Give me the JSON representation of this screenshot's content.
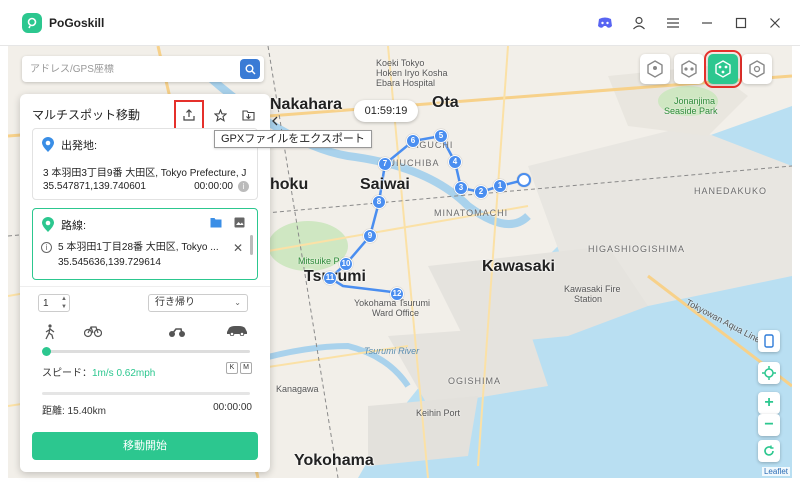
{
  "app": {
    "title": "PoGoskill"
  },
  "search": {
    "placeholder": "アドレス/GPS座標"
  },
  "panel": {
    "title": "マルチスポット移動",
    "start": {
      "label": "出発地:",
      "address": "3 本羽田3丁目9番 大田区, Tokyo Prefecture, J",
      "coords": "35.547871,139.740601",
      "time": "00:00:00"
    },
    "route": {
      "label": "路線:",
      "address": "5 本羽田1丁目28番 大田区, Tokyo ...",
      "coords": "35.545636,139.729614"
    },
    "repeat_count": "1",
    "mode_select": "行き帰り",
    "speed_label": "スピード：",
    "speed_value": "1m/s 0.62mph",
    "km": "K",
    "mi": "M",
    "distance": "距離: 15.40km",
    "elapsed": "00:00:00",
    "start_button": "移動開始"
  },
  "tooltip": "GPXファイルをエクスポート",
  "timer": "01:59:19",
  "map": {
    "labels": {
      "nakahara": "Nakahara",
      "ota": "Ota",
      "saiwai": "Saiwai",
      "kawasaki": "Kawasaki",
      "tsurumi": "Tsurumi",
      "yokohama": "Yokohama",
      "hoku": "hoku",
      "koeki": "Koeki Tokyo",
      "koeki2": "Hoken Iryo Kosha",
      "koeki3": "Ebara Hospital",
      "jonanjima": "Jonanjima",
      "jonanjima2": "Seaside Park",
      "yaguchi": "YAGUCHI",
      "fuiuchiba": "FUIUCHIBA",
      "minatomachi": "MINATOMACHI",
      "hanedaairport": "HANEDAKUKO",
      "higashiogishima": "HIGASHIOGISHIMA",
      "mitsuike": "Mitsuike Park",
      "kawasaki_fire": "Kawasaki Fire",
      "kawasaki_fire2": "Station",
      "yokohama_ward": "Yokohama Tsurumi",
      "yokohama_ward2": "Ward Office",
      "tsurumi_river": "Tsurumi River",
      "ogishima": "OGISHIMA",
      "keihin": "Keihin Port",
      "tokyowan": "Tokyowan Aqua Line",
      "kanagawa": "Kanagawa",
      "tsurumi_mk": "Tsurumi"
    },
    "route_markers": [
      "1",
      "2",
      "3",
      "4",
      "5",
      "6",
      "7",
      "8",
      "9",
      "10",
      "11",
      "12"
    ],
    "leaflet": "Leaflet"
  },
  "controls": {
    "zoom_in": "+",
    "zoom_out": "−"
  },
  "colors": {
    "accent": "#2cc78f",
    "route": "#4a8ef0",
    "highlight": "#e5302b"
  }
}
